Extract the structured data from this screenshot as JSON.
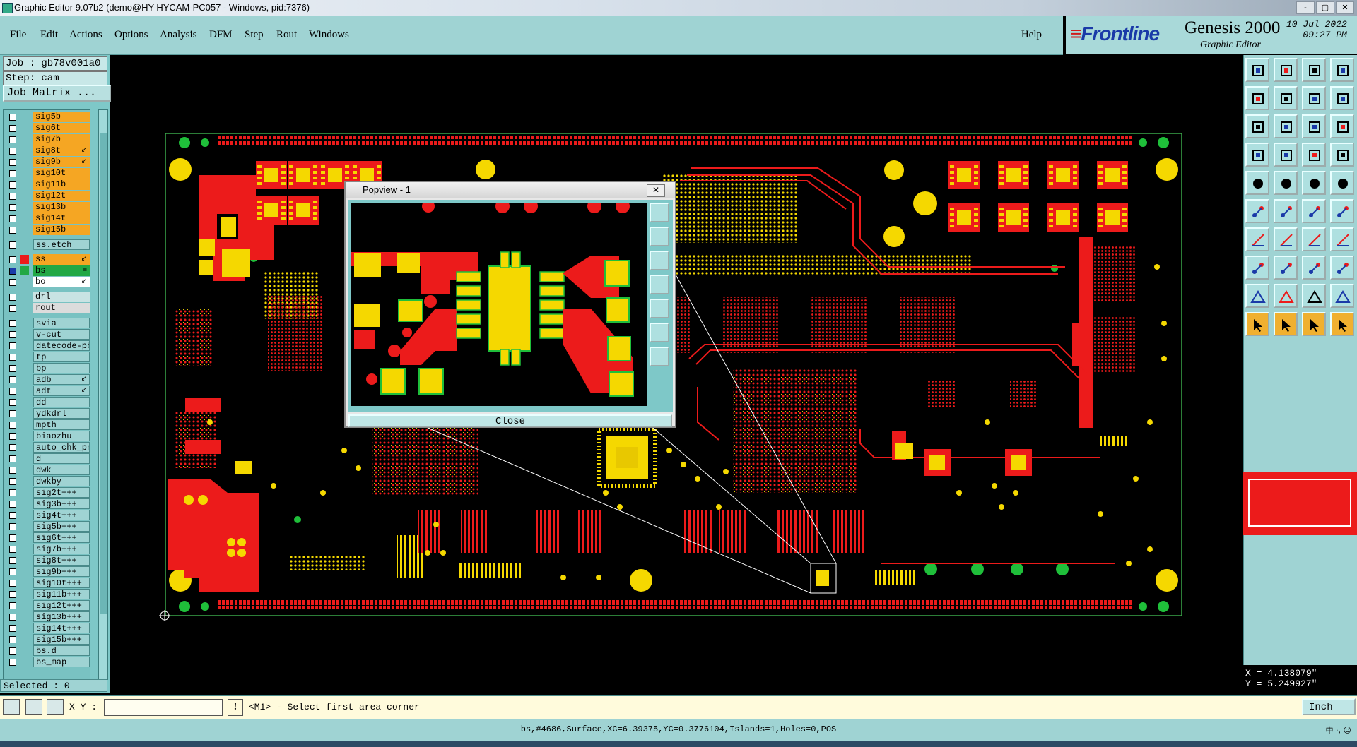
{
  "window": {
    "title": "Graphic Editor 9.07b2 (demo@HY-HYCAM-PC057 - Windows, pid:7376)",
    "buttons": [
      "-",
      "▢",
      "✕"
    ]
  },
  "menu": {
    "items": [
      "File",
      "Edit",
      "Actions",
      "Options",
      "Analysis",
      "DFM",
      "Step",
      "Rout",
      "Windows"
    ],
    "help": "Help"
  },
  "brand": {
    "logo": "Frontline",
    "product": "Genesis 2000",
    "subtitle": "Graphic Editor",
    "date": "10 Jul 2022",
    "time": "09:27 PM"
  },
  "job": {
    "job_line": "Job : gb78v001a0",
    "step_line": "Step: cam",
    "matrix_button": "Job Matrix ..."
  },
  "layers": [
    {
      "name": "sig5b",
      "bg": "#f5a623",
      "flag": ""
    },
    {
      "name": "sig6t",
      "bg": "#f5a623",
      "flag": ""
    },
    {
      "name": "sig7b",
      "bg": "#f5a623",
      "flag": ""
    },
    {
      "name": "sig8t",
      "bg": "#f5a623",
      "flag": "↙"
    },
    {
      "name": "sig9b",
      "bg": "#f5a623",
      "flag": "↙"
    },
    {
      "name": "sig10t",
      "bg": "#f5a623",
      "flag": ""
    },
    {
      "name": "sig11b",
      "bg": "#f5a623",
      "flag": ""
    },
    {
      "name": "sig12t",
      "bg": "#f5a623",
      "flag": ""
    },
    {
      "name": "sig13b",
      "bg": "#f5a623",
      "flag": ""
    },
    {
      "name": "sig14t",
      "bg": "#f5a623",
      "flag": ""
    },
    {
      "name": "sig15b",
      "bg": "#f5a623",
      "flag": ""
    },
    {
      "name": "ss.etch",
      "bg": "#9fd3d3",
      "flag": "",
      "gap": true
    },
    {
      "name": "ss",
      "bg": "#f5a623",
      "flag": "↙",
      "gap": true,
      "swatch": "#ec1b1b"
    },
    {
      "name": "bs",
      "bg": "#22a845",
      "flag": "≡",
      "swatch": "#22a845",
      "active": true
    },
    {
      "name": "bo",
      "bg": "#ffffff",
      "flag": "↙"
    },
    {
      "name": "drl",
      "bg": "#c9e3e3",
      "flag": "",
      "gap": true
    },
    {
      "name": "rout",
      "bg": "#dcdcdc",
      "flag": ""
    },
    {
      "name": "svia",
      "bg": "#9fd3d3",
      "flag": "",
      "gap": true
    },
    {
      "name": "v-cut",
      "bg": "#9fd3d3",
      "flag": ""
    },
    {
      "name": "datecode-pbe",
      "bg": "#9fd3d3",
      "flag": ""
    },
    {
      "name": "tp",
      "bg": "#9fd3d3",
      "flag": ""
    },
    {
      "name": "bp",
      "bg": "#9fd3d3",
      "flag": ""
    },
    {
      "name": "adb",
      "bg": "#9fd3d3",
      "flag": "↙"
    },
    {
      "name": "adt",
      "bg": "#9fd3d3",
      "flag": "↙"
    },
    {
      "name": "dd",
      "bg": "#9fd3d3",
      "flag": ""
    },
    {
      "name": "ydkdrl",
      "bg": "#9fd3d3",
      "flag": ""
    },
    {
      "name": "mpth",
      "bg": "#9fd3d3",
      "flag": ""
    },
    {
      "name": "biaozhu",
      "bg": "#9fd3d3",
      "flag": ""
    },
    {
      "name": "auto_chk_pn",
      "bg": "#9fd3d3",
      "flag": ""
    },
    {
      "name": "d",
      "bg": "#9fd3d3",
      "flag": ""
    },
    {
      "name": "dwk",
      "bg": "#9fd3d3",
      "flag": ""
    },
    {
      "name": "dwkby",
      "bg": "#9fd3d3",
      "flag": ""
    },
    {
      "name": "sig2t+++",
      "bg": "#9fd3d3",
      "flag": ""
    },
    {
      "name": "sig3b+++",
      "bg": "#9fd3d3",
      "flag": ""
    },
    {
      "name": "sig4t+++",
      "bg": "#9fd3d3",
      "flag": ""
    },
    {
      "name": "sig5b+++",
      "bg": "#9fd3d3",
      "flag": ""
    },
    {
      "name": "sig6t+++",
      "bg": "#9fd3d3",
      "flag": ""
    },
    {
      "name": "sig7b+++",
      "bg": "#9fd3d3",
      "flag": ""
    },
    {
      "name": "sig8t+++",
      "bg": "#9fd3d3",
      "flag": ""
    },
    {
      "name": "sig9b+++",
      "bg": "#9fd3d3",
      "flag": ""
    },
    {
      "name": "sig10t+++",
      "bg": "#9fd3d3",
      "flag": ""
    },
    {
      "name": "sig11b+++",
      "bg": "#9fd3d3",
      "flag": ""
    },
    {
      "name": "sig12t+++",
      "bg": "#9fd3d3",
      "flag": ""
    },
    {
      "name": "sig13b+++",
      "bg": "#9fd3d3",
      "flag": ""
    },
    {
      "name": "sig14t+++",
      "bg": "#9fd3d3",
      "flag": ""
    },
    {
      "name": "sig15b+++",
      "bg": "#9fd3d3",
      "flag": ""
    },
    {
      "name": "bs.d",
      "bg": "#9fd3d3",
      "flag": ""
    },
    {
      "name": "bs_map",
      "bg": "#9fd3d3",
      "flag": ""
    }
  ],
  "selected": "Selected : 0",
  "popview": {
    "title": "Popview - 1",
    "close_label": "Close",
    "x_label": "✕"
  },
  "toolbar_icons": [
    "open-icon",
    "save-icon",
    "home-icon",
    "layout-icon",
    "prev-step-icon",
    "next-step-icon",
    "split-icon",
    "flow-icon",
    "zoom-fit-icon",
    "zoom-center-icon",
    "scale-1to2-icon",
    "help-icon",
    "measure-icon",
    "pad-icon",
    "layers-icon",
    "filter-icon",
    "snapshot-icon",
    "graph-icon",
    "ruler-icon",
    "circle-icon",
    "node-add-icon",
    "node-delete-icon",
    "move-icon",
    "copy-icon",
    "line-icon",
    "draw-line-icon",
    "arc-icon",
    "polygon-icon",
    "select-icon",
    "minus-icon",
    "align-icon",
    "group-icon",
    "triangle-icon",
    "peak-icon",
    "trapezoid-icon",
    "arch-icon",
    "pointer-icon",
    "pointer-add-icon",
    "pointer-sub-icon",
    "pointer-all-icon"
  ],
  "coords": {
    "x": "X = 4.138079\"",
    "y": "Y = 5.249927\""
  },
  "command": {
    "xy_label": "X Y :",
    "xy_value": "",
    "bang": "!",
    "message": "<M1> - Select first area corner",
    "unit": "Inch"
  },
  "status": {
    "text": "bs,#4686,Surface,XC=6.39375,YC=0.3776104,Islands=1,Holes=0,POS",
    "ime": "中 ·, ☺"
  },
  "colors": {
    "panel": "#9fd3d3",
    "copper_red": "#ec1b1b",
    "pad_yellow": "#f5d800",
    "pad_green": "#1fbf3a"
  }
}
